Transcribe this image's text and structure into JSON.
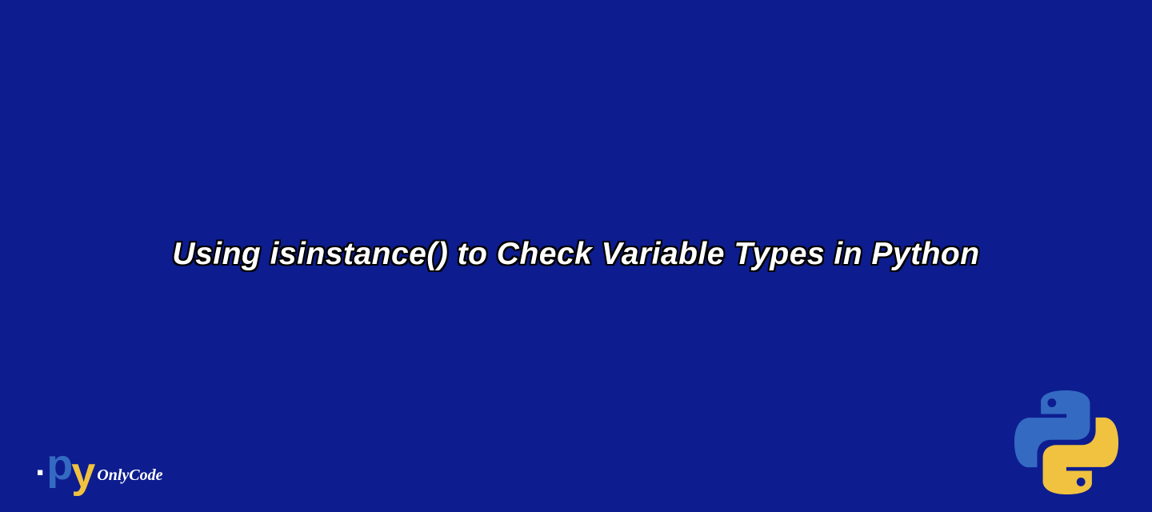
{
  "title": "Using isinstance() to Check Variable Types in Python",
  "logo": {
    "dot": ".",
    "p": "p",
    "y": "y",
    "text": "OnlyCode"
  },
  "colors": {
    "background": "#0d1d8f",
    "logo_p": "#346ac2",
    "logo_y": "#f0c23f",
    "white": "#ffffff"
  }
}
